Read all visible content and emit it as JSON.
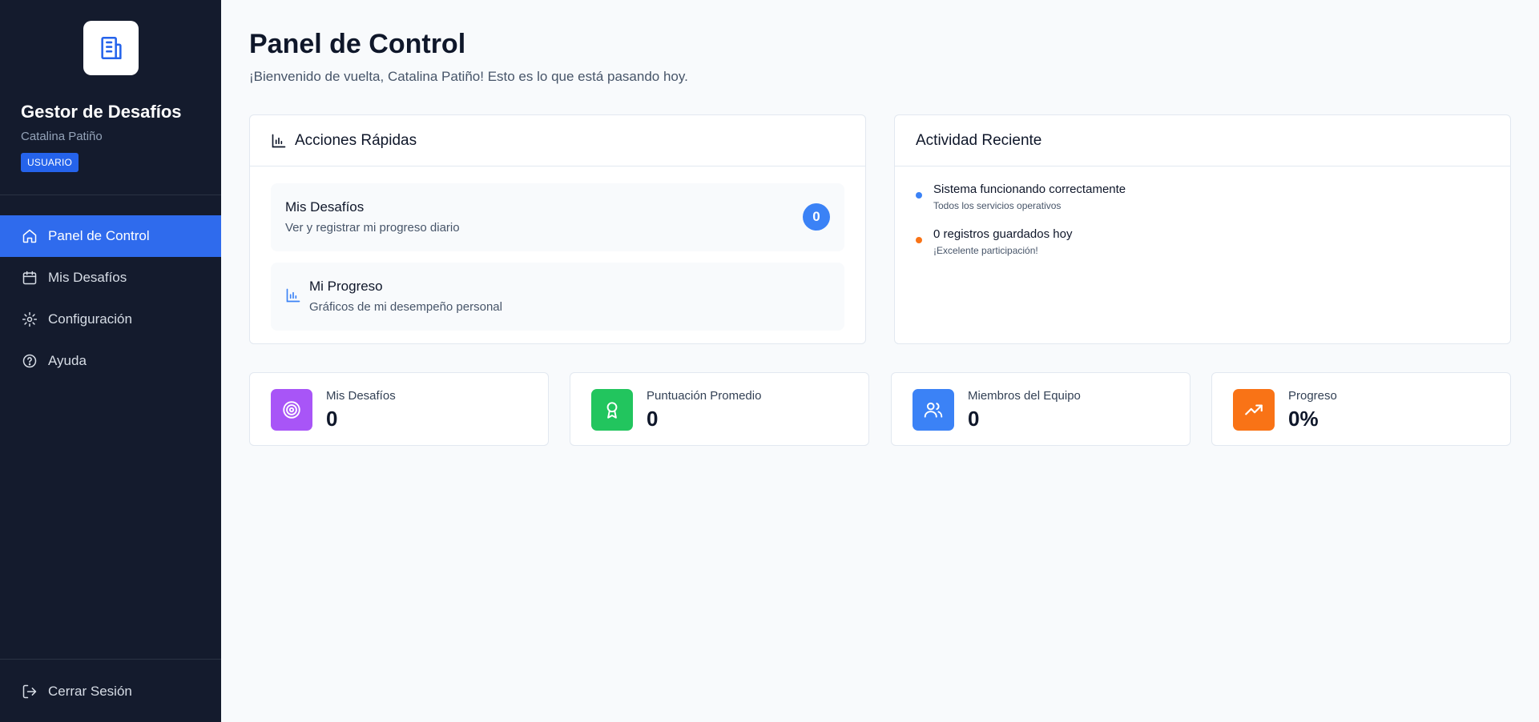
{
  "sidebar": {
    "app_title": "Gestor de Desafíos",
    "user_name": "Catalina Patiño",
    "role": "USUARIO",
    "nav": [
      {
        "label": "Panel de Control",
        "icon": "home-icon",
        "active": true
      },
      {
        "label": "Mis Desafíos",
        "icon": "calendar-icon"
      },
      {
        "label": "Configuración",
        "icon": "gear-icon"
      },
      {
        "label": "Ayuda",
        "icon": "help-circle-icon"
      }
    ],
    "logout_label": "Cerrar Sesión"
  },
  "header": {
    "title": "Panel de Control",
    "subtitle": "¡Bienvenido de vuelta, Catalina Patiño! Esto es lo que está pasando hoy."
  },
  "quick_actions": {
    "title": "Acciones Rápidas",
    "items": [
      {
        "title": "Mis Desafíos",
        "description": "Ver y registrar mi progreso diario",
        "badge": "0"
      },
      {
        "title": "Mi Progreso",
        "description": "Gráficos de mi desempeño personal"
      }
    ]
  },
  "recent_activity": {
    "title": "Actividad Reciente",
    "items": [
      {
        "title": "Sistema funcionando correctamente",
        "description": "Todos los servicios operativos",
        "color": "#3b82f6"
      },
      {
        "title": "0 registros guardados hoy",
        "description": "¡Excelente participación!",
        "color": "#f97316"
      }
    ]
  },
  "stats": [
    {
      "label": "Mis Desafíos",
      "value": "0",
      "icon": "target-icon",
      "color": "#a855f7"
    },
    {
      "label": "Puntuación Promedio",
      "value": "0",
      "icon": "award-icon",
      "color": "#22c55e"
    },
    {
      "label": "Miembros del Equipo",
      "value": "0",
      "icon": "users-icon",
      "color": "#3b82f6"
    },
    {
      "label": "Progreso",
      "value": "0%",
      "icon": "trending-up-icon",
      "color": "#f97316"
    }
  ],
  "colors": {
    "sidebar_bg": "#141b2d",
    "accent": "#2f6bed",
    "page_bg": "#f8fafc"
  }
}
